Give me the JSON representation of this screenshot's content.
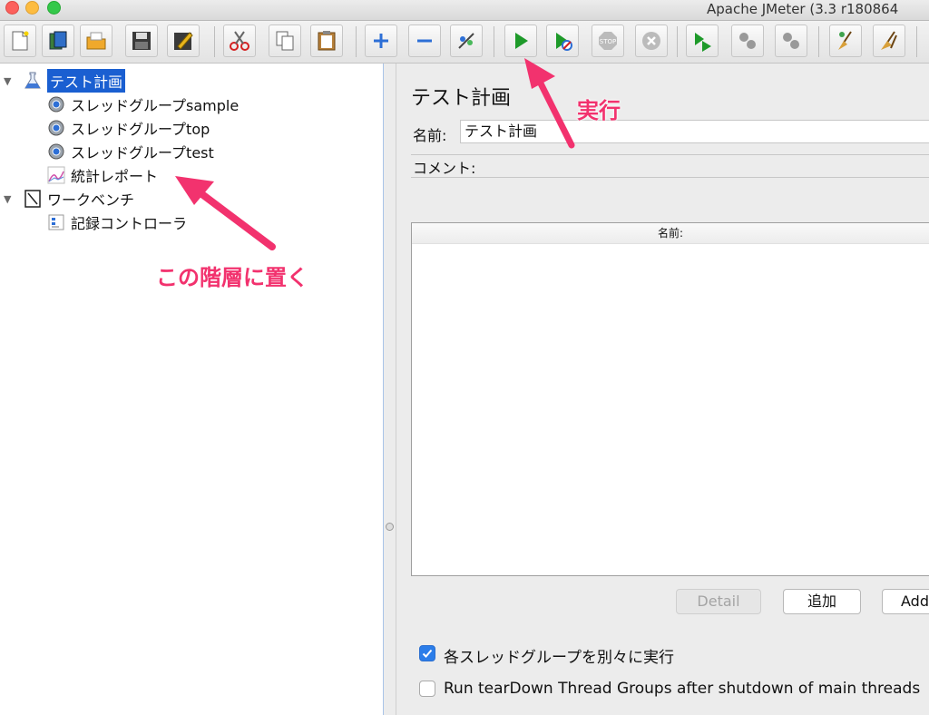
{
  "window": {
    "title": "Apache JMeter (3.3 r180864"
  },
  "toolbar": {
    "buttons": [
      {
        "name": "new",
        "icon": "new-document-icon"
      },
      {
        "name": "templates",
        "icon": "templates-icon"
      },
      {
        "name": "open",
        "icon": "open-folder-icon"
      },
      {
        "name": "save",
        "icon": "save-disk-icon"
      },
      {
        "name": "save-as",
        "icon": "save-as-icon"
      },
      {
        "name": "cut",
        "icon": "scissors-icon"
      },
      {
        "name": "copy",
        "icon": "copy-icon"
      },
      {
        "name": "paste",
        "icon": "clipboard-icon"
      },
      {
        "name": "expand",
        "icon": "plus-icon"
      },
      {
        "name": "collapse",
        "icon": "minus-icon"
      },
      {
        "name": "toggle",
        "icon": "toggle-icon"
      },
      {
        "name": "start",
        "icon": "play-icon"
      },
      {
        "name": "start-no-pause",
        "icon": "play-no-timer-icon"
      },
      {
        "name": "stop",
        "icon": "stop-icon"
      },
      {
        "name": "shutdown",
        "icon": "shutdown-icon"
      },
      {
        "name": "remote-start",
        "icon": "remote-start-icon"
      },
      {
        "name": "remote-stop",
        "icon": "remote-stop-icon"
      },
      {
        "name": "remote-shutdown",
        "icon": "remote-shutdown-icon"
      },
      {
        "name": "clear",
        "icon": "broom-icon"
      },
      {
        "name": "clear-all",
        "icon": "broom-all-icon"
      }
    ]
  },
  "tree": {
    "test_plan": "テスト計画",
    "thread_group_sample": "スレッドグループsample",
    "thread_group_top": "スレッドグループtop",
    "thread_group_test": "スレッドグループtest",
    "summary_report": "統計レポート",
    "workbench": "ワークベンチ",
    "recording_controller": "記録コントローラ"
  },
  "main": {
    "title": "テスト計画",
    "name_label": "名前:",
    "name_value": "テスト計画",
    "comment_label": "コメント:",
    "table_header": "名前:",
    "detail_button": "Detail",
    "add_button": "追加",
    "add_clipboard_button": "Add",
    "checkbox_functional": "各スレッドグループを別々に実行",
    "checkbox_functional_checked": true,
    "checkbox_teardown": "Run tearDown Thread Groups after shutdown of main threads",
    "checkbox_teardown_checked": false
  },
  "annotations": {
    "run": "実行",
    "place_here": "この階層に置く"
  },
  "colors": {
    "annotation": "#f2326e",
    "selection": "#1a5fd1",
    "start_green": "#1e9a2a",
    "checkbox_blue": "#2b7de9"
  }
}
